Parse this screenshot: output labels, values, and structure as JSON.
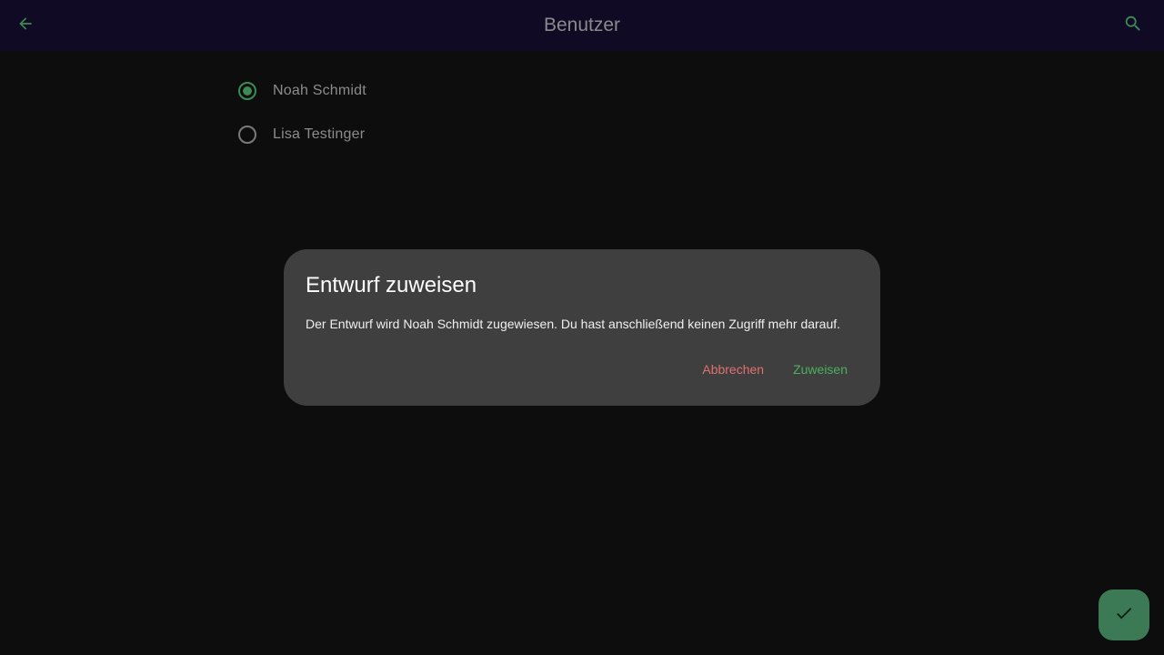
{
  "topbar": {
    "title": "Benutzer",
    "back_icon": "arrow-back-icon",
    "search_icon": "search-icon",
    "background": "#100a24"
  },
  "users": [
    {
      "name": "Noah Schmidt",
      "selected": true
    },
    {
      "name": "Lisa Testinger",
      "selected": false
    }
  ],
  "dialog": {
    "title": "Entwurf zuweisen",
    "body": "Der Entwurf wird Noah Schmidt zugewiesen. Du hast anschließend keinen Zugriff mehr darauf.",
    "cancel_label": "Abbrechen",
    "confirm_label": "Zuweisen"
  },
  "fab": {
    "icon": "check-icon"
  },
  "colors": {
    "accent": "#3d8a55",
    "cancel": "#e07070",
    "confirm": "#4caf5e",
    "dialog_bg": "#3f3f3f"
  }
}
